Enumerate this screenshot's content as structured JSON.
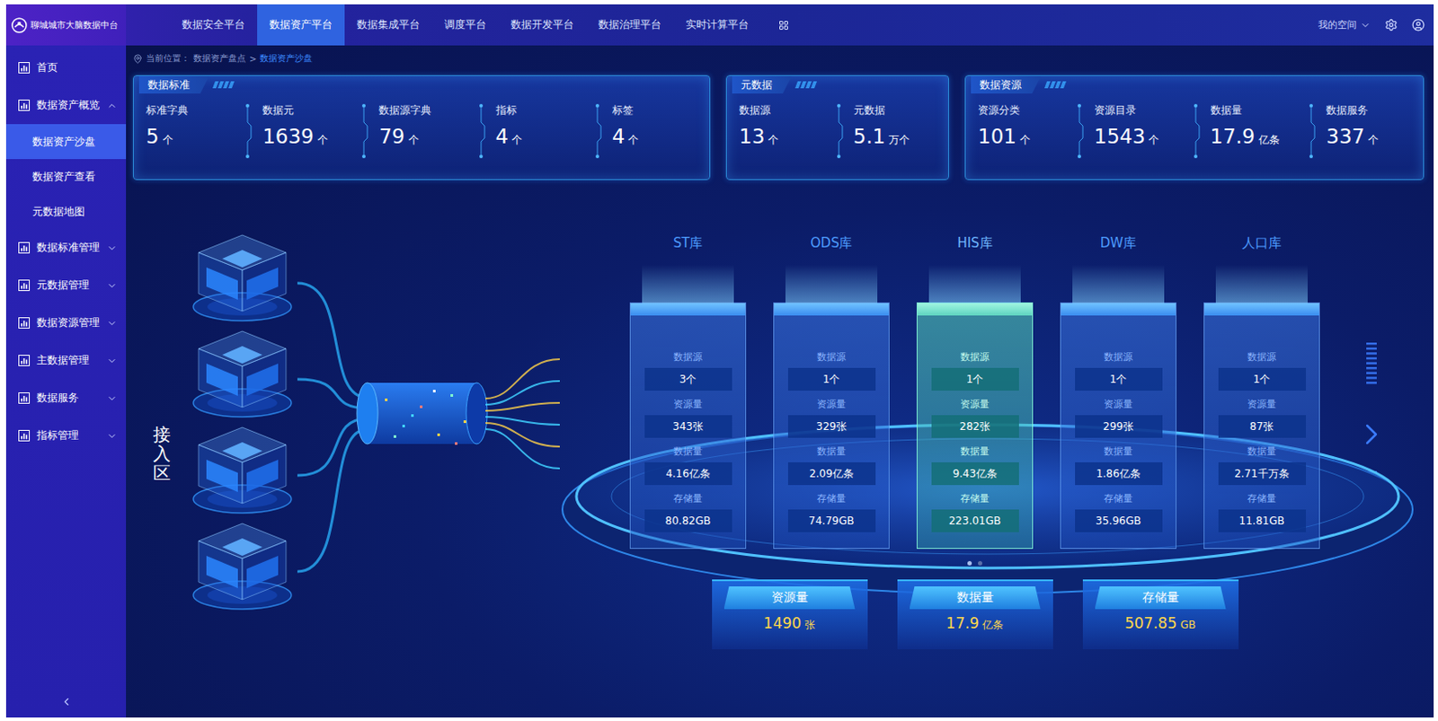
{
  "header": {
    "logo": "聊城城市大脑数据中台",
    "nav": [
      {
        "label": "数据安全平台",
        "selected": false
      },
      {
        "label": "数据资产平台",
        "selected": true
      },
      {
        "label": "数据集成平台",
        "selected": false
      },
      {
        "label": "调度平台",
        "selected": false
      },
      {
        "label": "数据开发平台",
        "selected": false
      },
      {
        "label": "数据治理平台",
        "selected": false
      },
      {
        "label": "实时计算平台",
        "selected": false
      }
    ],
    "user_menu": "我的空间"
  },
  "sidebar": {
    "items": [
      {
        "label": "首页",
        "kind": "leaf",
        "selected": false,
        "expanded": false,
        "children": []
      },
      {
        "label": "数据资产概览",
        "kind": "group",
        "selected": false,
        "expanded": true,
        "children": [
          {
            "label": "数据资产沙盘",
            "selected": true
          },
          {
            "label": "数据资产查看",
            "selected": false
          },
          {
            "label": "元数据地图",
            "selected": false
          }
        ]
      },
      {
        "label": "数据标准管理",
        "kind": "group",
        "selected": false,
        "expanded": false,
        "children": []
      },
      {
        "label": "元数据管理",
        "kind": "group",
        "selected": false,
        "expanded": false,
        "children": []
      },
      {
        "label": "数据资源管理",
        "kind": "group",
        "selected": false,
        "expanded": false,
        "children": []
      },
      {
        "label": "主数据管理",
        "kind": "group",
        "selected": false,
        "expanded": false,
        "children": []
      },
      {
        "label": "数据服务",
        "kind": "group",
        "selected": false,
        "expanded": false,
        "children": []
      },
      {
        "label": "指标管理",
        "kind": "group",
        "selected": false,
        "expanded": false,
        "children": []
      }
    ]
  },
  "breadcrumb": {
    "prefix": "当前位置：",
    "separator": ">",
    "items": [
      {
        "label": "数据资产盘点",
        "current": false
      },
      {
        "label": "数据资产沙盘",
        "current": true
      }
    ]
  },
  "stat_panels": [
    {
      "title": "数据标准",
      "stats": [
        {
          "label": "标准字典",
          "value": "5",
          "unit": "个"
        },
        {
          "label": "数据元",
          "value": "1639",
          "unit": "个"
        },
        {
          "label": "数据源字典",
          "value": "79",
          "unit": "个"
        },
        {
          "label": "指标",
          "value": "4",
          "unit": "个"
        },
        {
          "label": "标签",
          "value": "4",
          "unit": "个"
        }
      ]
    },
    {
      "title": "元数据",
      "stats": [
        {
          "label": "数据源",
          "value": "13",
          "unit": "个"
        },
        {
          "label": "元数据",
          "value": "5.1",
          "unit": "万个"
        }
      ]
    },
    {
      "title": "数据资源",
      "stats": [
        {
          "label": "资源分类",
          "value": "101",
          "unit": "个"
        },
        {
          "label": "资源目录",
          "value": "1543",
          "unit": "个"
        },
        {
          "label": "数据量",
          "value": "17.9",
          "unit": "亿条"
        },
        {
          "label": "数据服务",
          "value": "337",
          "unit": "个"
        }
      ]
    }
  ],
  "intake": {
    "label": "接入区"
  },
  "databases": [
    {
      "name": "ST库",
      "selected": false,
      "fields": [
        {
          "label": "数据源",
          "value": "3个"
        },
        {
          "label": "资源量",
          "value": "343张"
        },
        {
          "label": "数据量",
          "value": "4.16亿条"
        },
        {
          "label": "存储量",
          "value": "80.82GB"
        }
      ]
    },
    {
      "name": "ODS库",
      "selected": false,
      "fields": [
        {
          "label": "数据源",
          "value": "1个"
        },
        {
          "label": "资源量",
          "value": "329张"
        },
        {
          "label": "数据量",
          "value": "2.09亿条"
        },
        {
          "label": "存储量",
          "value": "74.79GB"
        }
      ]
    },
    {
      "name": "HIS库",
      "selected": true,
      "fields": [
        {
          "label": "数据源",
          "value": "1个"
        },
        {
          "label": "资源量",
          "value": "282张"
        },
        {
          "label": "数据量",
          "value": "9.43亿条"
        },
        {
          "label": "存储量",
          "value": "223.01GB"
        }
      ]
    },
    {
      "name": "DW库",
      "selected": false,
      "fields": [
        {
          "label": "数据源",
          "value": "1个"
        },
        {
          "label": "资源量",
          "value": "299张"
        },
        {
          "label": "数据量",
          "value": "1.86亿条"
        },
        {
          "label": "存储量",
          "value": "35.96GB"
        }
      ]
    },
    {
      "name": "人口库",
      "selected": false,
      "fields": [
        {
          "label": "数据源",
          "value": "1个"
        },
        {
          "label": "资源量",
          "value": "87张"
        },
        {
          "label": "数据量",
          "value": "2.71千万条"
        },
        {
          "label": "存储量",
          "value": "11.81GB"
        }
      ]
    }
  ],
  "pages": [
    {
      "selected": true
    },
    {
      "selected": false
    }
  ],
  "totals": [
    {
      "label": "资源量",
      "value": "1490",
      "unit": "张"
    },
    {
      "label": "数据量",
      "value": "17.9",
      "unit": "亿条"
    },
    {
      "label": "存储量",
      "value": "507.85",
      "unit": "GB"
    }
  ]
}
